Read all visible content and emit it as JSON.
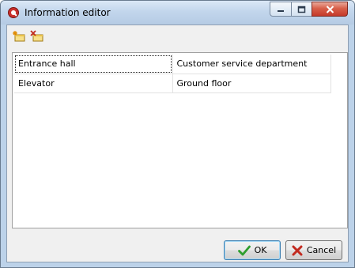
{
  "window": {
    "title": "Information editor"
  },
  "toolbar": {
    "add_icon": "add-row-icon",
    "delete_icon": "delete-row-icon"
  },
  "grid": {
    "rows": [
      [
        "Entrance hall",
        "Customer service department"
      ],
      [
        "Elevator",
        "Ground floor"
      ]
    ]
  },
  "buttons": {
    "ok_label": "OK",
    "cancel_label": "Cancel"
  },
  "colors": {
    "ok_check": "#2e9e2e",
    "cancel_x": "#c22a1f",
    "close_button": "#c5392a"
  }
}
